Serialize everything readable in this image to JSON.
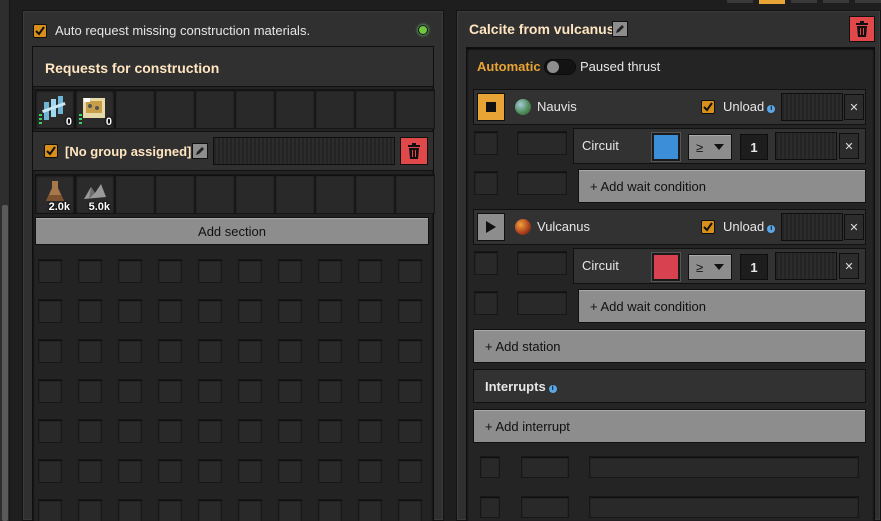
{
  "left": {
    "auto_request_label": "Auto request missing construction materials.",
    "auto_request_checked": true,
    "status_color": "#6cc93c",
    "requests_title": "Requests for construction",
    "logistic_slots": [
      {
        "icon": "rail-item-icon",
        "count": "0"
      },
      {
        "icon": "circuit-blueprint-item-icon",
        "count": "0"
      }
    ],
    "group_label": "[No group assigned]",
    "group_checked": true,
    "section_items": [
      {
        "icon": "calcite-item-icon",
        "count": "2.0k"
      },
      {
        "icon": "stone-item-icon",
        "count": "5.0k"
      }
    ],
    "add_section_label": "Add section"
  },
  "right": {
    "title": "Calcite from vulcanus",
    "automatic_label": "Automatic",
    "paused_label": "Paused thrust",
    "stations": [
      {
        "name": "Nauvis",
        "planet_color": "#4f8f5a",
        "active": true,
        "unload_label": "Unload",
        "unload_checked": true,
        "condition": {
          "label": "Circuit",
          "color": "#3c8ed9",
          "operator": "≥",
          "value": "1"
        },
        "add_wait_label": "+ Add wait condition"
      },
      {
        "name": "Vulcanus",
        "planet_color": "#b0431f",
        "active": false,
        "unload_label": "Unload",
        "unload_checked": true,
        "condition": {
          "label": "Circuit",
          "color": "#d8414f",
          "operator": "≥",
          "value": "1"
        },
        "add_wait_label": "+ Add wait condition"
      }
    ],
    "add_station_label": "+ Add station",
    "interrupts_label": "Interrupts",
    "add_interrupt_label": "+ Add interrupt"
  },
  "colors": {
    "accent": "#d98f1b",
    "danger": "#e1484a",
    "title": "#ffe6c0"
  }
}
